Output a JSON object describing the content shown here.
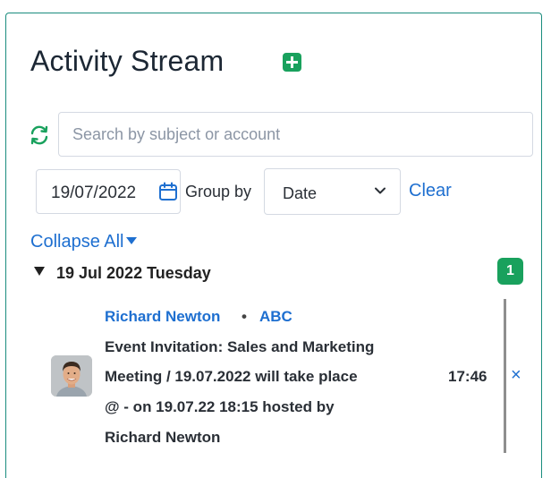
{
  "header": {
    "title": "Activity Stream",
    "add_icon": "plus-square-icon",
    "accent": "#19a15d"
  },
  "search": {
    "placeholder": "Search by subject or account",
    "value": ""
  },
  "filters": {
    "date": "19/07/2022",
    "group_by_label": "Group by",
    "group_by_value": "Date",
    "clear_label": "Clear"
  },
  "collapse_all_label": "Collapse All",
  "groups": [
    {
      "header": "19 Jul 2022 Tuesday",
      "count": "1",
      "items": [
        {
          "author": "Richard Newton",
          "separator": "•",
          "account": "ABC",
          "subject_lines": [
            "Event Invitation: Sales and Marketing",
            "Meeting / 19.07.2022 will take place",
            "@ - on 19.07.22 18:15 hosted by",
            "Richard Newton"
          ],
          "time": "17:46",
          "close_glyph": "×"
        }
      ]
    }
  ],
  "colors": {
    "link": "#1e6fd0",
    "border": "#1a8c7e",
    "badge": "#19a15d"
  }
}
